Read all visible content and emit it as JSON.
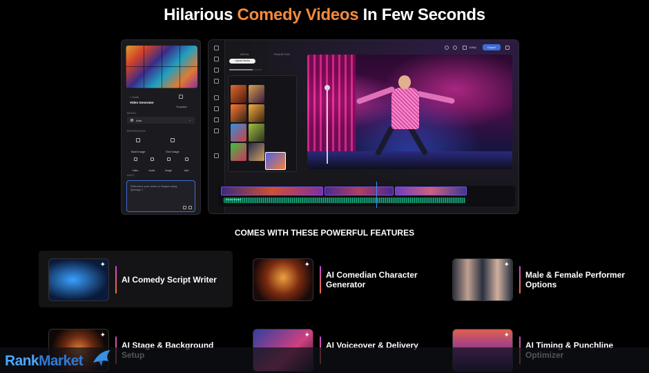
{
  "headline": {
    "part1": "Hilarious ",
    "accent": "Comedy Videos",
    "part2": " In Few Seconds"
  },
  "colors": {
    "accent": "#f58a3c",
    "primary_blue": "#3b6fd8",
    "feature_bar_top": "#d040e0",
    "feature_bar_bottom": "#f07030"
  },
  "generator_panel": {
    "back_label": "< Tools",
    "title": "Video Generator",
    "templates_label": "Templates",
    "model_section": "MODEL",
    "model_value": "Auto",
    "references_section": "REFERENCES",
    "start_image": "Start Image",
    "end_image": "End Image",
    "ref_video": "Video",
    "ref_audio": "Audio",
    "ref_image": "Image",
    "ref_add": "Add",
    "shot_section": "SHOT",
    "prompt_placeholder": "Reference your video or images using @image 1"
  },
  "editor": {
    "tabs": [
      "MEDIA",
      "TRANSITION"
    ],
    "upload_label": "Upload Media",
    "zoom_slider_fraction": 0.7,
    "resolution": "1080p",
    "export_label": "Export",
    "audio_clip_label": "Ha-ha-ha.mp3",
    "icons": [
      "star-icon",
      "media-icon",
      "text-icon",
      "music-icon",
      "effects-icon",
      "transition-icon",
      "shape-icon",
      "sticker-icon",
      "settings-icon"
    ]
  },
  "features_title": "COMES WITH THESE POWERFUL FEATURES",
  "features": [
    {
      "label": "AI Comedy Script Writer",
      "thumb": "writer"
    },
    {
      "label": "AI Comedian Character Generator",
      "thumb": "character"
    },
    {
      "label": "Male & Female Performer Options",
      "thumb": "performers"
    },
    {
      "label": "AI Stage & Background Setup",
      "thumb": "stage"
    },
    {
      "label": "AI Voiceover & Delivery",
      "thumb": "voiceover"
    },
    {
      "label": "AI Timing & Punchline Optimizer",
      "thumb": "timing"
    }
  ],
  "brand": {
    "part1": "Rank",
    "part2": "Market"
  }
}
